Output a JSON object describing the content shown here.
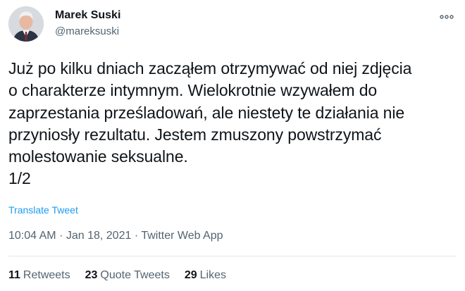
{
  "tweet": {
    "author": {
      "name": "Marek Suski",
      "handle": "@mareksuski"
    },
    "text_lines": [
      "Już po kilku dniach zacząłem otrzymywać od niej zdjęcia",
      "o charakterze intymnym. Wielokrotnie wzywałem do",
      "zaprzestania prześladowań, ale niestety te działania nie",
      "przyniosły rezultatu. Jestem zmuszony powstrzymać",
      "molestowanie seksualne.",
      "1/2"
    ],
    "translate_label": "Translate Tweet",
    "meta": {
      "time": "10:04 AM",
      "date": "Jan 18, 2021",
      "source": "Twitter Web App",
      "separator": "·"
    },
    "stats": {
      "retweets_count": "11",
      "retweets_label": "Retweets",
      "quotes_count": "23",
      "quotes_label": "Quote Tweets",
      "likes_count": "29",
      "likes_label": "Likes"
    }
  },
  "colors": {
    "text": "#0f1419",
    "secondary": "#536471",
    "link": "#1d9bf0"
  },
  "icons": {
    "more": "more-horizontal-icon"
  }
}
